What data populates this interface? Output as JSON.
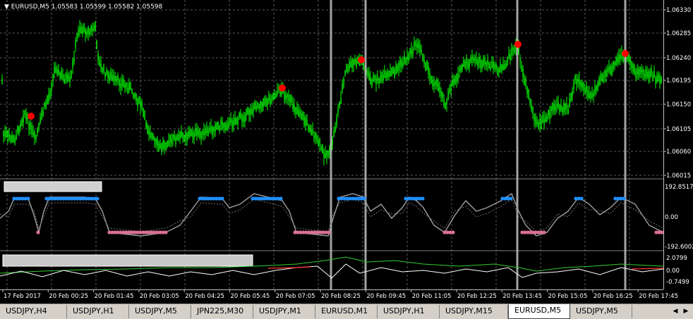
{
  "chart": {
    "symbol": "EURUSD,M5",
    "ohlc": "1.05583 1.05599 1.05582 1.05598",
    "price_ticks": [
      "1.06330",
      "1.06285",
      "1.06240",
      "1.06195",
      "1.06150",
      "1.06105",
      "1.06060",
      "1.06015"
    ],
    "osc1_ticks": [
      "192.8517",
      "0.00",
      "-192.6002"
    ],
    "osc2_ticks": [
      "2.0799",
      "0.00",
      "-0.7499"
    ],
    "time_labels": [
      "17 Feb 2017",
      "20 Feb 00:25",
      "20 Feb 01:45",
      "20 Feb 03:05",
      "20 Feb 04:25",
      "20 Feb 05:45",
      "20 Feb 07:05",
      "20 Feb 08:25",
      "20 Feb 09:45",
      "20 Feb 11:05",
      "20 Feb 12:25",
      "20 Feb 13:45",
      "20 Feb 15:05",
      "20 Feb 16:25",
      "20 Feb 17:45"
    ],
    "colors": {
      "background": "#000000",
      "candle": "#00ff00",
      "signal_dot": "#ff0000",
      "osc_high": "#1e90ff",
      "osc_low": "#db7093",
      "osc_line": "#a0a0a0",
      "grid": "#5a5a5a",
      "vertical_marker": "#c0c0c0",
      "macd_green": "#32cd32",
      "macd_white": "#ffffff",
      "macd_red": "#ff3030"
    }
  },
  "tabs": [
    {
      "label": "USDJPY,H4"
    },
    {
      "label": "USDJPY,H1"
    },
    {
      "label": "USDJPY,M5"
    },
    {
      "label": "JPN225,M30"
    },
    {
      "label": "USDJPY,M1"
    },
    {
      "label": "EURUSD,M1"
    },
    {
      "label": "USDJPY,H1"
    },
    {
      "label": "USDJPY,M15"
    },
    {
      "label": "EURUSD,M5",
      "active": true
    },
    {
      "label": "USDJPY,M5"
    }
  ],
  "tab_scroll": {
    "left_icon": "scroll-left-icon",
    "right_icon": "scroll-right-icon"
  }
}
